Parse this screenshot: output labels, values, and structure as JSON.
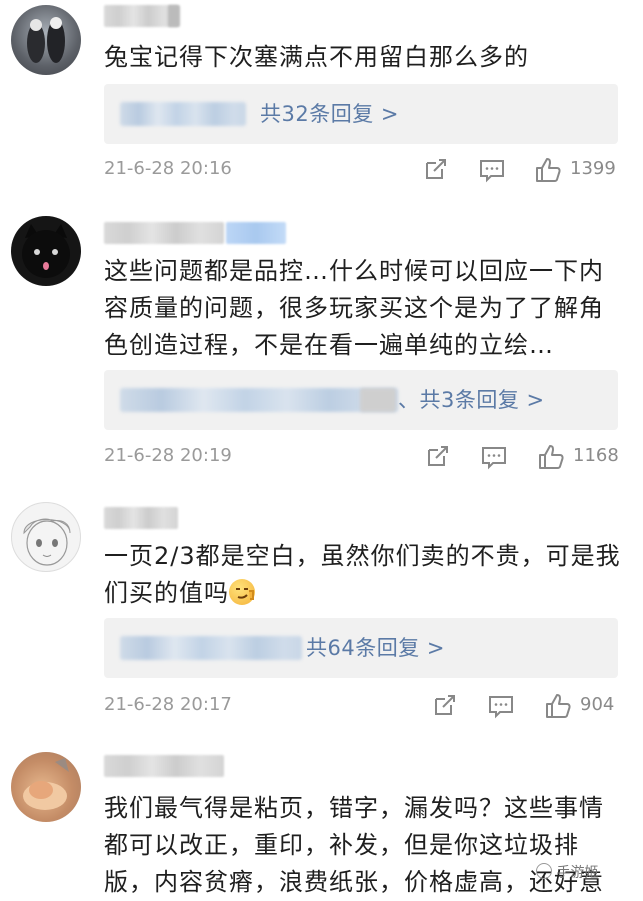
{
  "comments": [
    {
      "text": "兔宝记得下次塞满点不用留白那么多的",
      "reply_link": "共32条回复 >",
      "time": "21-6-28 20:16",
      "likes": "1399"
    },
    {
      "text": "这些问题都是品控…什么时候可以回应一下内容质量的问题，很多玩家买这个是为了了解角色创造过程，不是在看一遍单纯的立绘…",
      "reply_link": "、共3条回复 >",
      "time": "21-6-28 20:19",
      "likes": "1168"
    },
    {
      "text": "一页2/3都是空白，虽然你们卖的不贵，可是我们买的值吗",
      "reply_link": "共64条回复 >",
      "time": "21-6-28 20:17",
      "likes": "904"
    },
    {
      "text": "我们最气得是粘页，错字，漏发吗？这些事情都可以改正，重印，补发，但是你这垃圾排版，内容贫瘠，浪费纸张，价格虚高，还好意"
    }
  ],
  "icons": {
    "share": "share-icon",
    "comment": "comment-icon",
    "like": "thumbs-up-icon",
    "emoji": "smirk-emoji-icon"
  },
  "colors": {
    "link": "#5b7aa6",
    "meta": "#9a9a9a",
    "reply_bg": "#f1f1f1"
  },
  "watermark": "手游姬"
}
